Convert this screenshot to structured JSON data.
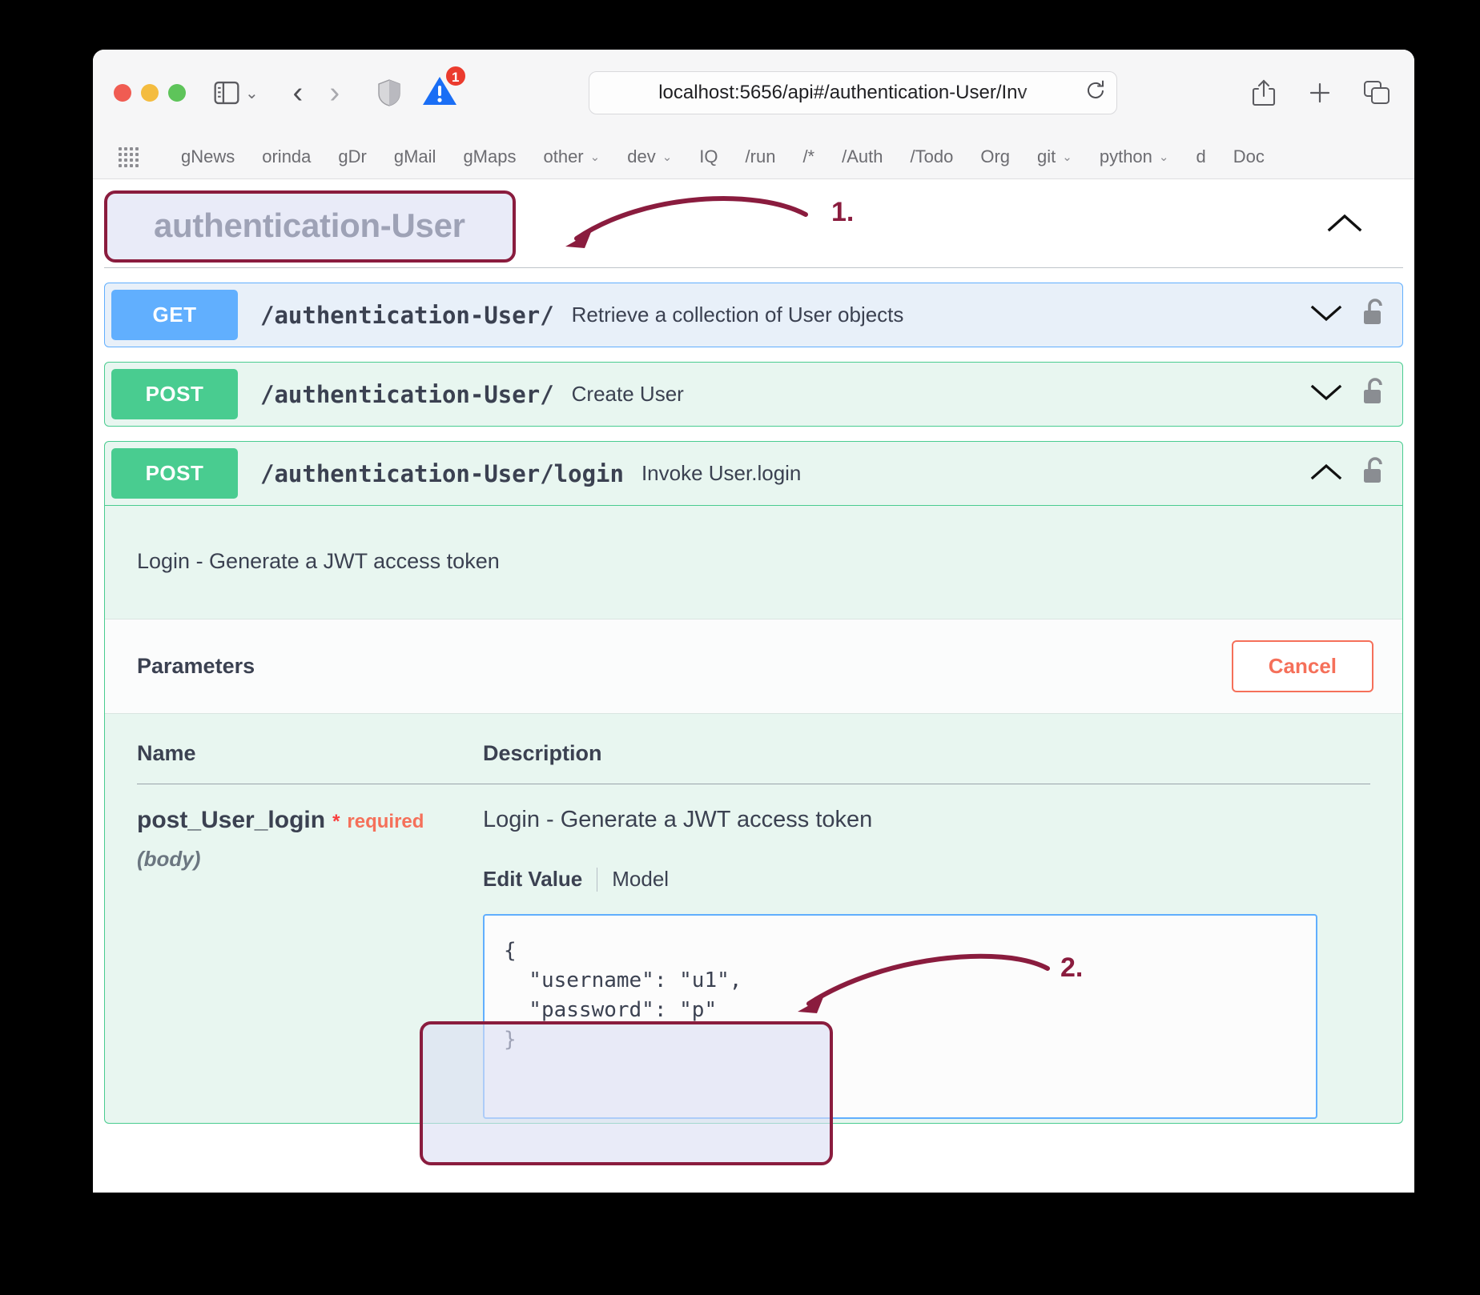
{
  "browser": {
    "url": "localhost:5656/api#/authentication-User/Inv",
    "warning_badge": "1",
    "icons": {
      "sidebar": "sidebar-icon",
      "back": "back-arrow-icon",
      "forward": "forward-arrow-icon",
      "shield": "shield-icon",
      "warning": "warning-triangle-icon",
      "reload": "reload-icon",
      "share": "share-icon",
      "new_tab": "plus-icon",
      "tab_overview": "tab-overview-icon"
    },
    "bookmarks": [
      {
        "label": "gNews",
        "dropdown": false
      },
      {
        "label": "orinda",
        "dropdown": false
      },
      {
        "label": "gDr",
        "dropdown": false
      },
      {
        "label": "gMail",
        "dropdown": false
      },
      {
        "label": "gMaps",
        "dropdown": false
      },
      {
        "label": "other",
        "dropdown": true
      },
      {
        "label": "dev",
        "dropdown": true
      },
      {
        "label": "IQ",
        "dropdown": false
      },
      {
        "label": "/run",
        "dropdown": false
      },
      {
        "label": "/*",
        "dropdown": false
      },
      {
        "label": "/Auth",
        "dropdown": false
      },
      {
        "label": "/Todo",
        "dropdown": false
      },
      {
        "label": "Org",
        "dropdown": false
      },
      {
        "label": "git",
        "dropdown": true
      },
      {
        "label": "python",
        "dropdown": true
      },
      {
        "label": "d",
        "dropdown": false
      },
      {
        "label": "Doc",
        "dropdown": false
      }
    ]
  },
  "swagger": {
    "tag_title": "authentication-User",
    "tag_collapse_icon": "chevron-up-icon",
    "operations": [
      {
        "verb": "GET",
        "path": "/authentication-User/",
        "summary": "Retrieve a collection of User objects",
        "caret": "chevron-down-icon",
        "lock": "unlocked-padlock-icon",
        "expanded": false
      },
      {
        "verb": "POST",
        "path": "/authentication-User/",
        "summary": "Create User",
        "caret": "chevron-down-icon",
        "lock": "unlocked-padlock-icon",
        "expanded": false
      },
      {
        "verb": "POST",
        "path": "/authentication-User/login",
        "summary": "Invoke User.login",
        "caret": "chevron-up-icon",
        "lock": "unlocked-padlock-icon",
        "expanded": true
      }
    ],
    "expanded_op": {
      "description": "Login - Generate a JWT access token",
      "parameters_title": "Parameters",
      "cancel_label": "Cancel",
      "columns": {
        "name": "Name",
        "description": "Description"
      },
      "param": {
        "name": "post_User_login",
        "required_star": "*",
        "required_label": "required",
        "type": "(body)",
        "description": "Login - Generate a JWT access token",
        "edit_value_tab": "Edit Value",
        "model_tab": "Model",
        "json_value": "{\n  \"username\": \"u1\",\n  \"password\": \"p\"\n}"
      }
    }
  },
  "annotations": [
    {
      "number": "1.",
      "target": "tag-title-box"
    },
    {
      "number": "2.",
      "target": "json-value-box"
    }
  ],
  "colors": {
    "get_blue": "#61affe",
    "post_green": "#49cc90",
    "cancel_red": "#f5705a",
    "required_red": "#f93e3e",
    "annotation_maroon": "#8a1c3e",
    "annotation_fill": "#dbdef4",
    "text_dark": "#3b4151"
  }
}
